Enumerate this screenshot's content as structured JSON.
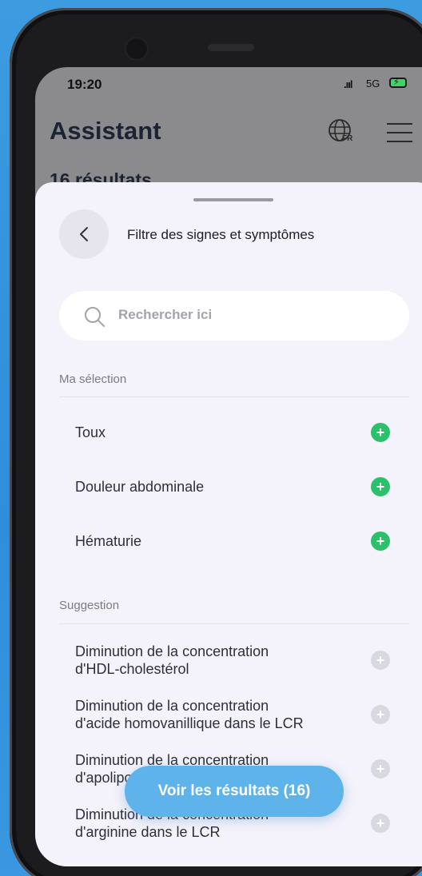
{
  "status_bar": {
    "time": "19:20",
    "network": "5G"
  },
  "header": {
    "title": "Assistant",
    "language": "FR",
    "results_text": "16 résultats"
  },
  "sheet": {
    "title": "Filtre des signes et symptômes",
    "search_placeholder": "Rechercher ici",
    "selection_label": "Ma sélection",
    "selection": [
      {
        "label": "Toux"
      },
      {
        "label": "Douleur abdominale"
      },
      {
        "label": "Hématurie"
      }
    ],
    "suggestion_label": "Suggestion",
    "suggestions": [
      {
        "line1": "Diminution de la concentration",
        "line2": "d'HDL-cholestérol"
      },
      {
        "line1": "Diminution de la concentration",
        "line2": "d'acide homovanillique dans le LCR"
      },
      {
        "line1": "Diminution de la concentration",
        "line2": "d'apolipoprotéine"
      },
      {
        "line1": "Diminution de la concentration",
        "line2": "d'arginine dans le LCR"
      }
    ],
    "cta_label": "Voir les résultats (16)"
  },
  "colors": {
    "accent": "#5db3ea",
    "selected_icon": "#2dc06a",
    "suggestion_icon": "#d8d8e1"
  }
}
